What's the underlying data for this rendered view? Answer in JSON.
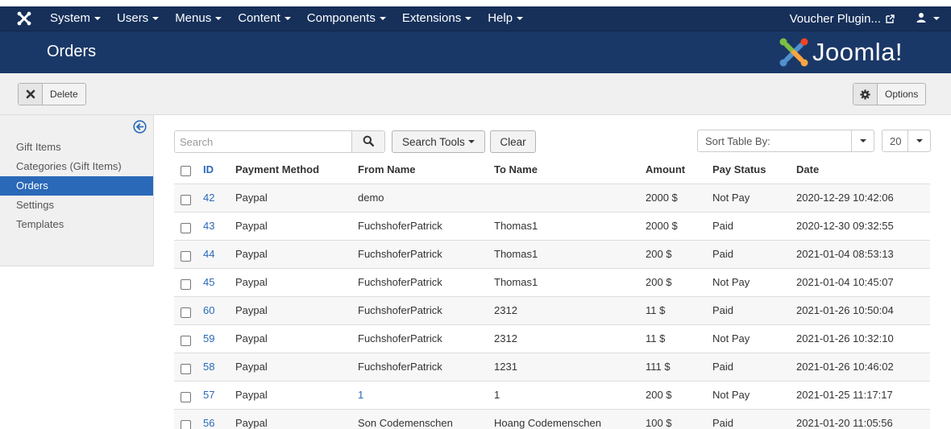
{
  "nav": {
    "menu": [
      "System",
      "Users",
      "Menus",
      "Content",
      "Components",
      "Extensions",
      "Help"
    ],
    "site_name": "Voucher Plugin...",
    "icons": {
      "logo": "joomla-logo-icon",
      "external": "external-link-icon",
      "user": "user-icon"
    }
  },
  "header": {
    "title": "Orders",
    "brand": "Joomla!"
  },
  "toolbar": {
    "delete_label": "Delete",
    "options_label": "Options"
  },
  "sidebar": {
    "items": [
      {
        "label": "Gift Items"
      },
      {
        "label": "Categories (Gift Items)"
      },
      {
        "label": "Orders",
        "active": true
      },
      {
        "label": "Settings"
      },
      {
        "label": "Templates"
      }
    ]
  },
  "filters": {
    "search_placeholder": "Search",
    "search_tools_label": "Search Tools",
    "clear_label": "Clear",
    "sort_placeholder": "Sort Table By:",
    "limit_value": "20"
  },
  "table": {
    "columns": [
      "ID",
      "Payment Method",
      "From Name",
      "To Name",
      "Amount",
      "Pay Status",
      "Date"
    ],
    "rows": [
      {
        "id": "42",
        "method": "Paypal",
        "from": "demo",
        "to": "",
        "amount": "2000 $",
        "status": "Not Pay",
        "date": "2020-12-29 10:42:06"
      },
      {
        "id": "43",
        "method": "Paypal",
        "from": "FuchshoferPatrick",
        "to": "Thomas1",
        "amount": "2000 $",
        "status": "Paid",
        "date": "2020-12-30 09:32:55"
      },
      {
        "id": "44",
        "method": "Paypal",
        "from": "FuchshoferPatrick",
        "to": "Thomas1",
        "amount": "200 $",
        "status": "Paid",
        "date": "2021-01-04 08:53:13"
      },
      {
        "id": "45",
        "method": "Paypal",
        "from": "FuchshoferPatrick",
        "to": "Thomas1",
        "amount": "200 $",
        "status": "Not Pay",
        "date": "2021-01-04 10:45:07"
      },
      {
        "id": "60",
        "method": "Paypal",
        "from": "FuchshoferPatrick",
        "to": "2312",
        "amount": "11 $",
        "status": "Paid",
        "date": "2021-01-26 10:50:04"
      },
      {
        "id": "59",
        "method": "Paypal",
        "from": "FuchshoferPatrick",
        "to": "2312",
        "amount": "11 $",
        "status": "Not Pay",
        "date": "2021-01-26 10:32:10"
      },
      {
        "id": "58",
        "method": "Paypal",
        "from": "FuchshoferPatrick",
        "to": "1231",
        "amount": "111 $",
        "status": "Paid",
        "date": "2021-01-26 10:46:02"
      },
      {
        "id": "57",
        "method": "Paypal",
        "from": "1",
        "to": "1",
        "amount": "200 $",
        "status": "Not Pay",
        "date": "2021-01-25 11:17:17",
        "from_link": true
      },
      {
        "id": "56",
        "method": "Paypal",
        "from": "Son Codemenschen",
        "to": "Hoang Codemenschen",
        "amount": "100 $",
        "status": "Paid",
        "date": "2021-01-20 11:05:56"
      }
    ]
  },
  "colors": {
    "navbar": "#16305a",
    "header": "#1a3867",
    "accent": "#2a69b8",
    "toolbar_bg": "#f0f0f0"
  }
}
